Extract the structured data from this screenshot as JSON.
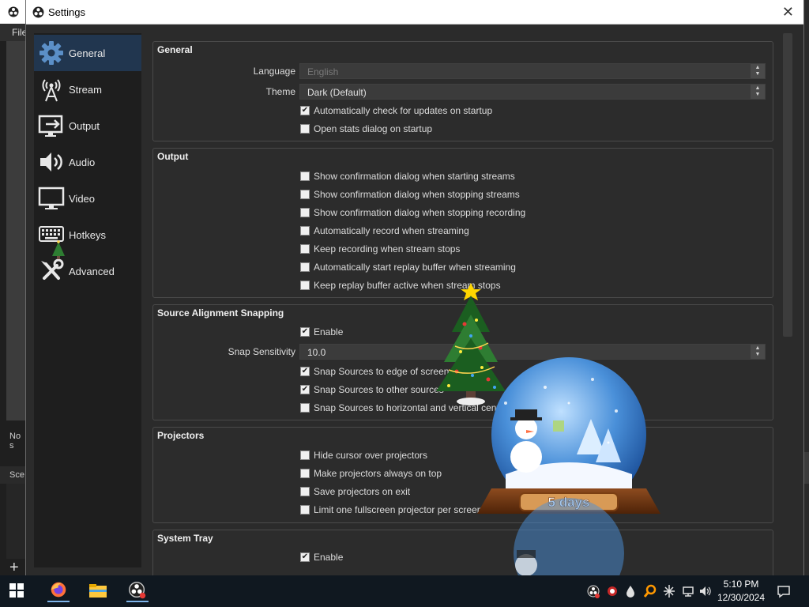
{
  "background_app": {
    "menu_file": "File",
    "no_source": "No s",
    "scenes": "Sce",
    "add_button": "+"
  },
  "dialog": {
    "title": "Settings",
    "close": "✕"
  },
  "sidebar": {
    "items": [
      {
        "label": "General",
        "icon": "gear-icon",
        "active": true
      },
      {
        "label": "Stream",
        "icon": "broadcast-tower-icon",
        "active": false
      },
      {
        "label": "Output",
        "icon": "output-monitor-icon",
        "active": false
      },
      {
        "label": "Audio",
        "icon": "speaker-icon",
        "active": false
      },
      {
        "label": "Video",
        "icon": "monitor-icon",
        "active": false
      },
      {
        "label": "Hotkeys",
        "icon": "keyboard-icon",
        "active": false
      },
      {
        "label": "Advanced",
        "icon": "wrench-screwdriver-icon",
        "active": false
      }
    ]
  },
  "general": {
    "title": "General",
    "language_label": "Language",
    "language_value": "English",
    "theme_label": "Theme",
    "theme_value": "Dark (Default)",
    "check_updates": "Automatically check for updates on startup",
    "check_updates_checked": true,
    "open_stats": "Open stats dialog on startup",
    "open_stats_checked": false
  },
  "output": {
    "title": "Output",
    "items": [
      {
        "label": "Show confirmation dialog when starting streams",
        "checked": false
      },
      {
        "label": "Show confirmation dialog when stopping streams",
        "checked": false
      },
      {
        "label": "Show confirmation dialog when stopping recording",
        "checked": false
      },
      {
        "label": "Automatically record when streaming",
        "checked": false
      },
      {
        "label": "Keep recording when stream stops",
        "checked": false
      },
      {
        "label": "Automatically start replay buffer when streaming",
        "checked": false
      },
      {
        "label": "Keep replay buffer active when stream stops",
        "checked": false
      }
    ]
  },
  "snapping": {
    "title": "Source Alignment Snapping",
    "enable": "Enable",
    "enable_checked": true,
    "sensitivity_label": "Snap Sensitivity",
    "sensitivity_value": "10.0",
    "items": [
      {
        "label": "Snap Sources to edge of screen",
        "checked": true
      },
      {
        "label": "Snap Sources to other sources",
        "checked": true
      },
      {
        "label": "Snap Sources to horizontal and vertical center",
        "checked": false
      }
    ]
  },
  "projectors": {
    "title": "Projectors",
    "items": [
      {
        "label": "Hide cursor over projectors",
        "checked": false
      },
      {
        "label": "Make projectors always on top",
        "checked": false
      },
      {
        "label": "Save projectors on exit",
        "checked": false
      },
      {
        "label": "Limit one fullscreen projector per screen",
        "checked": false
      }
    ]
  },
  "system_tray": {
    "title": "System Tray",
    "enable": "Enable",
    "enable_checked": true
  },
  "overlay": {
    "globe_text": "5 days"
  },
  "taskbar": {
    "apps": [
      "firefox-icon",
      "file-explorer-icon",
      "obs-icon"
    ],
    "time": "5:10 PM",
    "date": "12/30/2024"
  },
  "colors": {
    "sidebar_active": "#21364f",
    "dialog_bg": "#2b2b2b",
    "group_border": "#4a4a4a",
    "taskbar_bg": "#101820"
  }
}
